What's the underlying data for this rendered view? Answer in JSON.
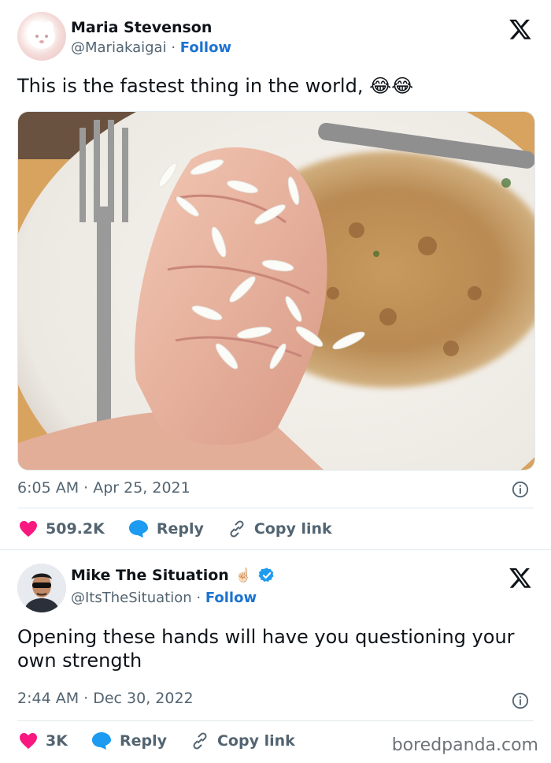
{
  "tweets": [
    {
      "author_name": "Maria Stevenson",
      "handle": "@Mariakaigai",
      "separator": "·",
      "follow_label": "Follow",
      "text": "This is the fastest thing in the world, 😂😂",
      "timestamp": "6:05 AM · Apr 25, 2021",
      "likes": "509.2K",
      "reply_label": "Reply",
      "copy_label": "Copy link",
      "verified": false
    },
    {
      "author_name": "Mike The Situation",
      "name_emoji": "☝🏻",
      "handle": "@ItsTheSituation",
      "separator": "·",
      "follow_label": "Follow",
      "text": "Opening these hands will have you questioning your own strength",
      "timestamp": "2:44 AM · Dec 30, 2022",
      "likes": "3K",
      "reply_label": "Reply",
      "copy_label": "Copy link",
      "verified": true
    }
  ],
  "watermark": "boredpanda.com",
  "colors": {
    "heart": "#f91880",
    "reply": "#1d9bf0",
    "follow": "#1d73d1",
    "verified": "#1d9bf0",
    "muted": "#536471"
  },
  "icons": [
    "x-logo-icon",
    "info-icon",
    "heart-icon",
    "reply-bubble-icon",
    "link-icon",
    "verified-badge-icon"
  ]
}
